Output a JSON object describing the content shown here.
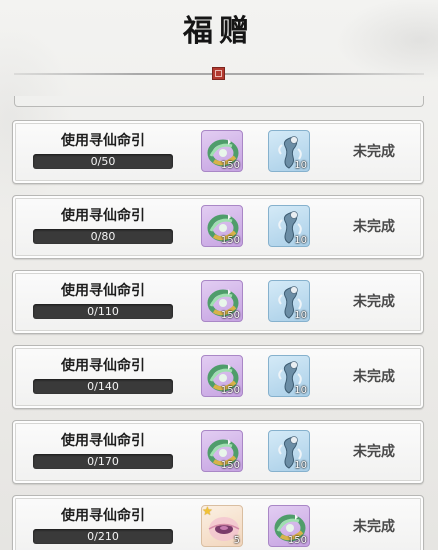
{
  "header": {
    "title": "福赠"
  },
  "tasks": [
    {
      "label": "使用寻仙命引",
      "progress_text": "0/50",
      "progress_fraction": 0,
      "status": "未完成",
      "rewards": [
        {
          "icon": "swirl-orb-icon",
          "count": "150",
          "rarity": "purple"
        },
        {
          "icon": "spirit-figure-icon",
          "count": "10",
          "rarity": "blue"
        }
      ]
    },
    {
      "label": "使用寻仙命引",
      "progress_text": "0/80",
      "progress_fraction": 0,
      "status": "未完成",
      "rewards": [
        {
          "icon": "swirl-orb-icon",
          "count": "150",
          "rarity": "purple"
        },
        {
          "icon": "spirit-figure-icon",
          "count": "10",
          "rarity": "blue"
        }
      ]
    },
    {
      "label": "使用寻仙命引",
      "progress_text": "0/110",
      "progress_fraction": 0,
      "status": "未完成",
      "rewards": [
        {
          "icon": "swirl-orb-icon",
          "count": "150",
          "rarity": "purple"
        },
        {
          "icon": "spirit-figure-icon",
          "count": "10",
          "rarity": "blue"
        }
      ]
    },
    {
      "label": "使用寻仙命引",
      "progress_text": "0/140",
      "progress_fraction": 0,
      "status": "未完成",
      "rewards": [
        {
          "icon": "swirl-orb-icon",
          "count": "150",
          "rarity": "purple"
        },
        {
          "icon": "spirit-figure-icon",
          "count": "10",
          "rarity": "blue"
        }
      ]
    },
    {
      "label": "使用寻仙命引",
      "progress_text": "0/170",
      "progress_fraction": 0,
      "status": "未完成",
      "rewards": [
        {
          "icon": "swirl-orb-icon",
          "count": "150",
          "rarity": "purple"
        },
        {
          "icon": "spirit-figure-icon",
          "count": "10",
          "rarity": "blue"
        }
      ]
    },
    {
      "label": "使用寻仙命引",
      "progress_text": "0/210",
      "progress_fraction": 0,
      "status": "未完成",
      "rewards": [
        {
          "icon": "pink-gem-icon",
          "count": "5",
          "rarity": "gold"
        },
        {
          "icon": "swirl-orb-icon",
          "count": "150",
          "rarity": "purple"
        }
      ]
    }
  ]
}
